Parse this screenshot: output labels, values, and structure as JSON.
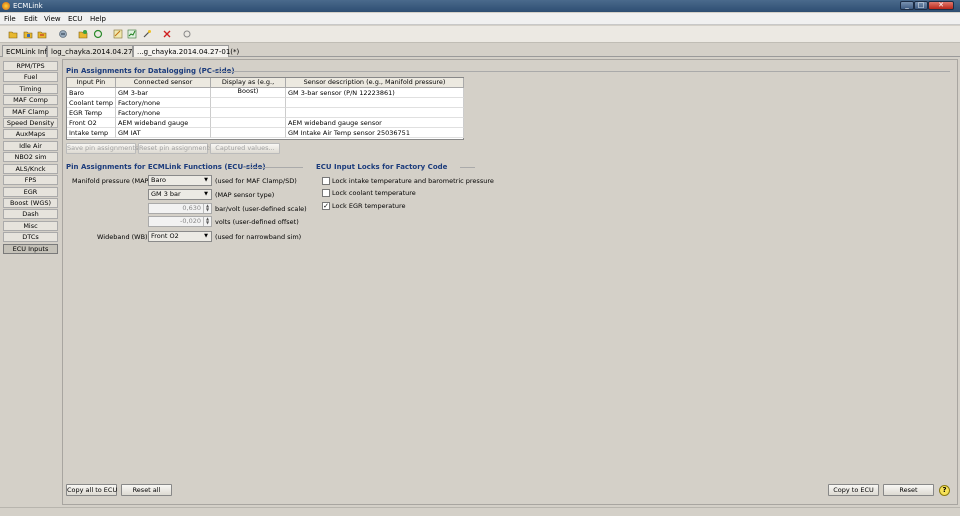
{
  "window": {
    "title": "ECMLink",
    "minimize": "_",
    "maximize": "□",
    "close": "✕"
  },
  "menu": [
    "File",
    "Edit",
    "View",
    "ECU",
    "Help"
  ],
  "toolbar_icons": [
    "open-folder-icon",
    "save-icon",
    "save-as-icon",
    "connect-icon",
    "add-icon",
    "refresh-icon",
    "edit-icon",
    "chart-icon",
    "wand-icon",
    "delete-icon",
    "reload-icon"
  ],
  "tabs": [
    "ECMLink Info",
    "log_chayka.2014.04.27-01'",
    "...g_chayka.2014.04.27-01(*)"
  ],
  "sidebar": [
    "RPM/TPS",
    "Fuel",
    "Timing",
    "MAF Comp",
    "MAF Clamp",
    "Speed Density",
    "AuxMaps",
    "Idle Air",
    "NBO2 sim",
    "ALS/Knck",
    "FPS",
    "EGR",
    "Boost (WGS)",
    "Dash",
    "Misc",
    "DTCs",
    "ECU Inputs"
  ],
  "datalog": {
    "title": "Pin Assignments for Datalogging (PC-side)",
    "headers": [
      "Input Pin",
      "Connected sensor",
      "Display as (e.g., Boost)",
      "Sensor description (e.g., Manifold pressure)"
    ],
    "rows": [
      [
        "Baro",
        "GM 3-bar",
        "",
        "GM 3-bar sensor (P/N 12223861)"
      ],
      [
        "Coolant temp",
        "Factory/none",
        "",
        ""
      ],
      [
        "EGR Temp",
        "Factory/none",
        "",
        ""
      ],
      [
        "Front O2",
        "AEM wideband gauge",
        "",
        "AEM wideband gauge sensor"
      ],
      [
        "Intake temp",
        "GM IAT",
        "",
        "GM Intake Air Temp sensor 25036751"
      ]
    ],
    "buttons": [
      "Save pin assignments",
      "Reset pin assignments",
      "Captured values..."
    ]
  },
  "ecu_side": {
    "title": "Pin Assignments for ECMLink Functions (ECU-side)",
    "map_label": "Manifold pressure (MAP):",
    "map_value": "Baro",
    "map_note": "(used for MAF Clamp/SD)",
    "sensor_type_value": "GM 3 bar",
    "sensor_type_note": "(MAP sensor type)",
    "scale_value": "0,630",
    "scale_note": "bar/volt (user-defined scale)",
    "offset_value": "-0,020",
    "offset_note": "volts (user-defined offset)",
    "wb_label": "Wideband (WB):",
    "wb_value": "Front O2",
    "wb_note": "(used for narrowband sim)"
  },
  "locks": {
    "title": "ECU Input Locks for Factory Code",
    "items": [
      {
        "label": "Lock intake temperature and barometric pressure",
        "checked": ""
      },
      {
        "label": "Lock coolant temperature",
        "checked": ""
      },
      {
        "label": "Lock EGR temperature",
        "checked": "✓"
      }
    ]
  },
  "footer": {
    "copy_all": "Copy all to ECU",
    "reset_all": "Reset all",
    "copy": "Copy to ECU",
    "reset": "Reset",
    "help": "?"
  }
}
